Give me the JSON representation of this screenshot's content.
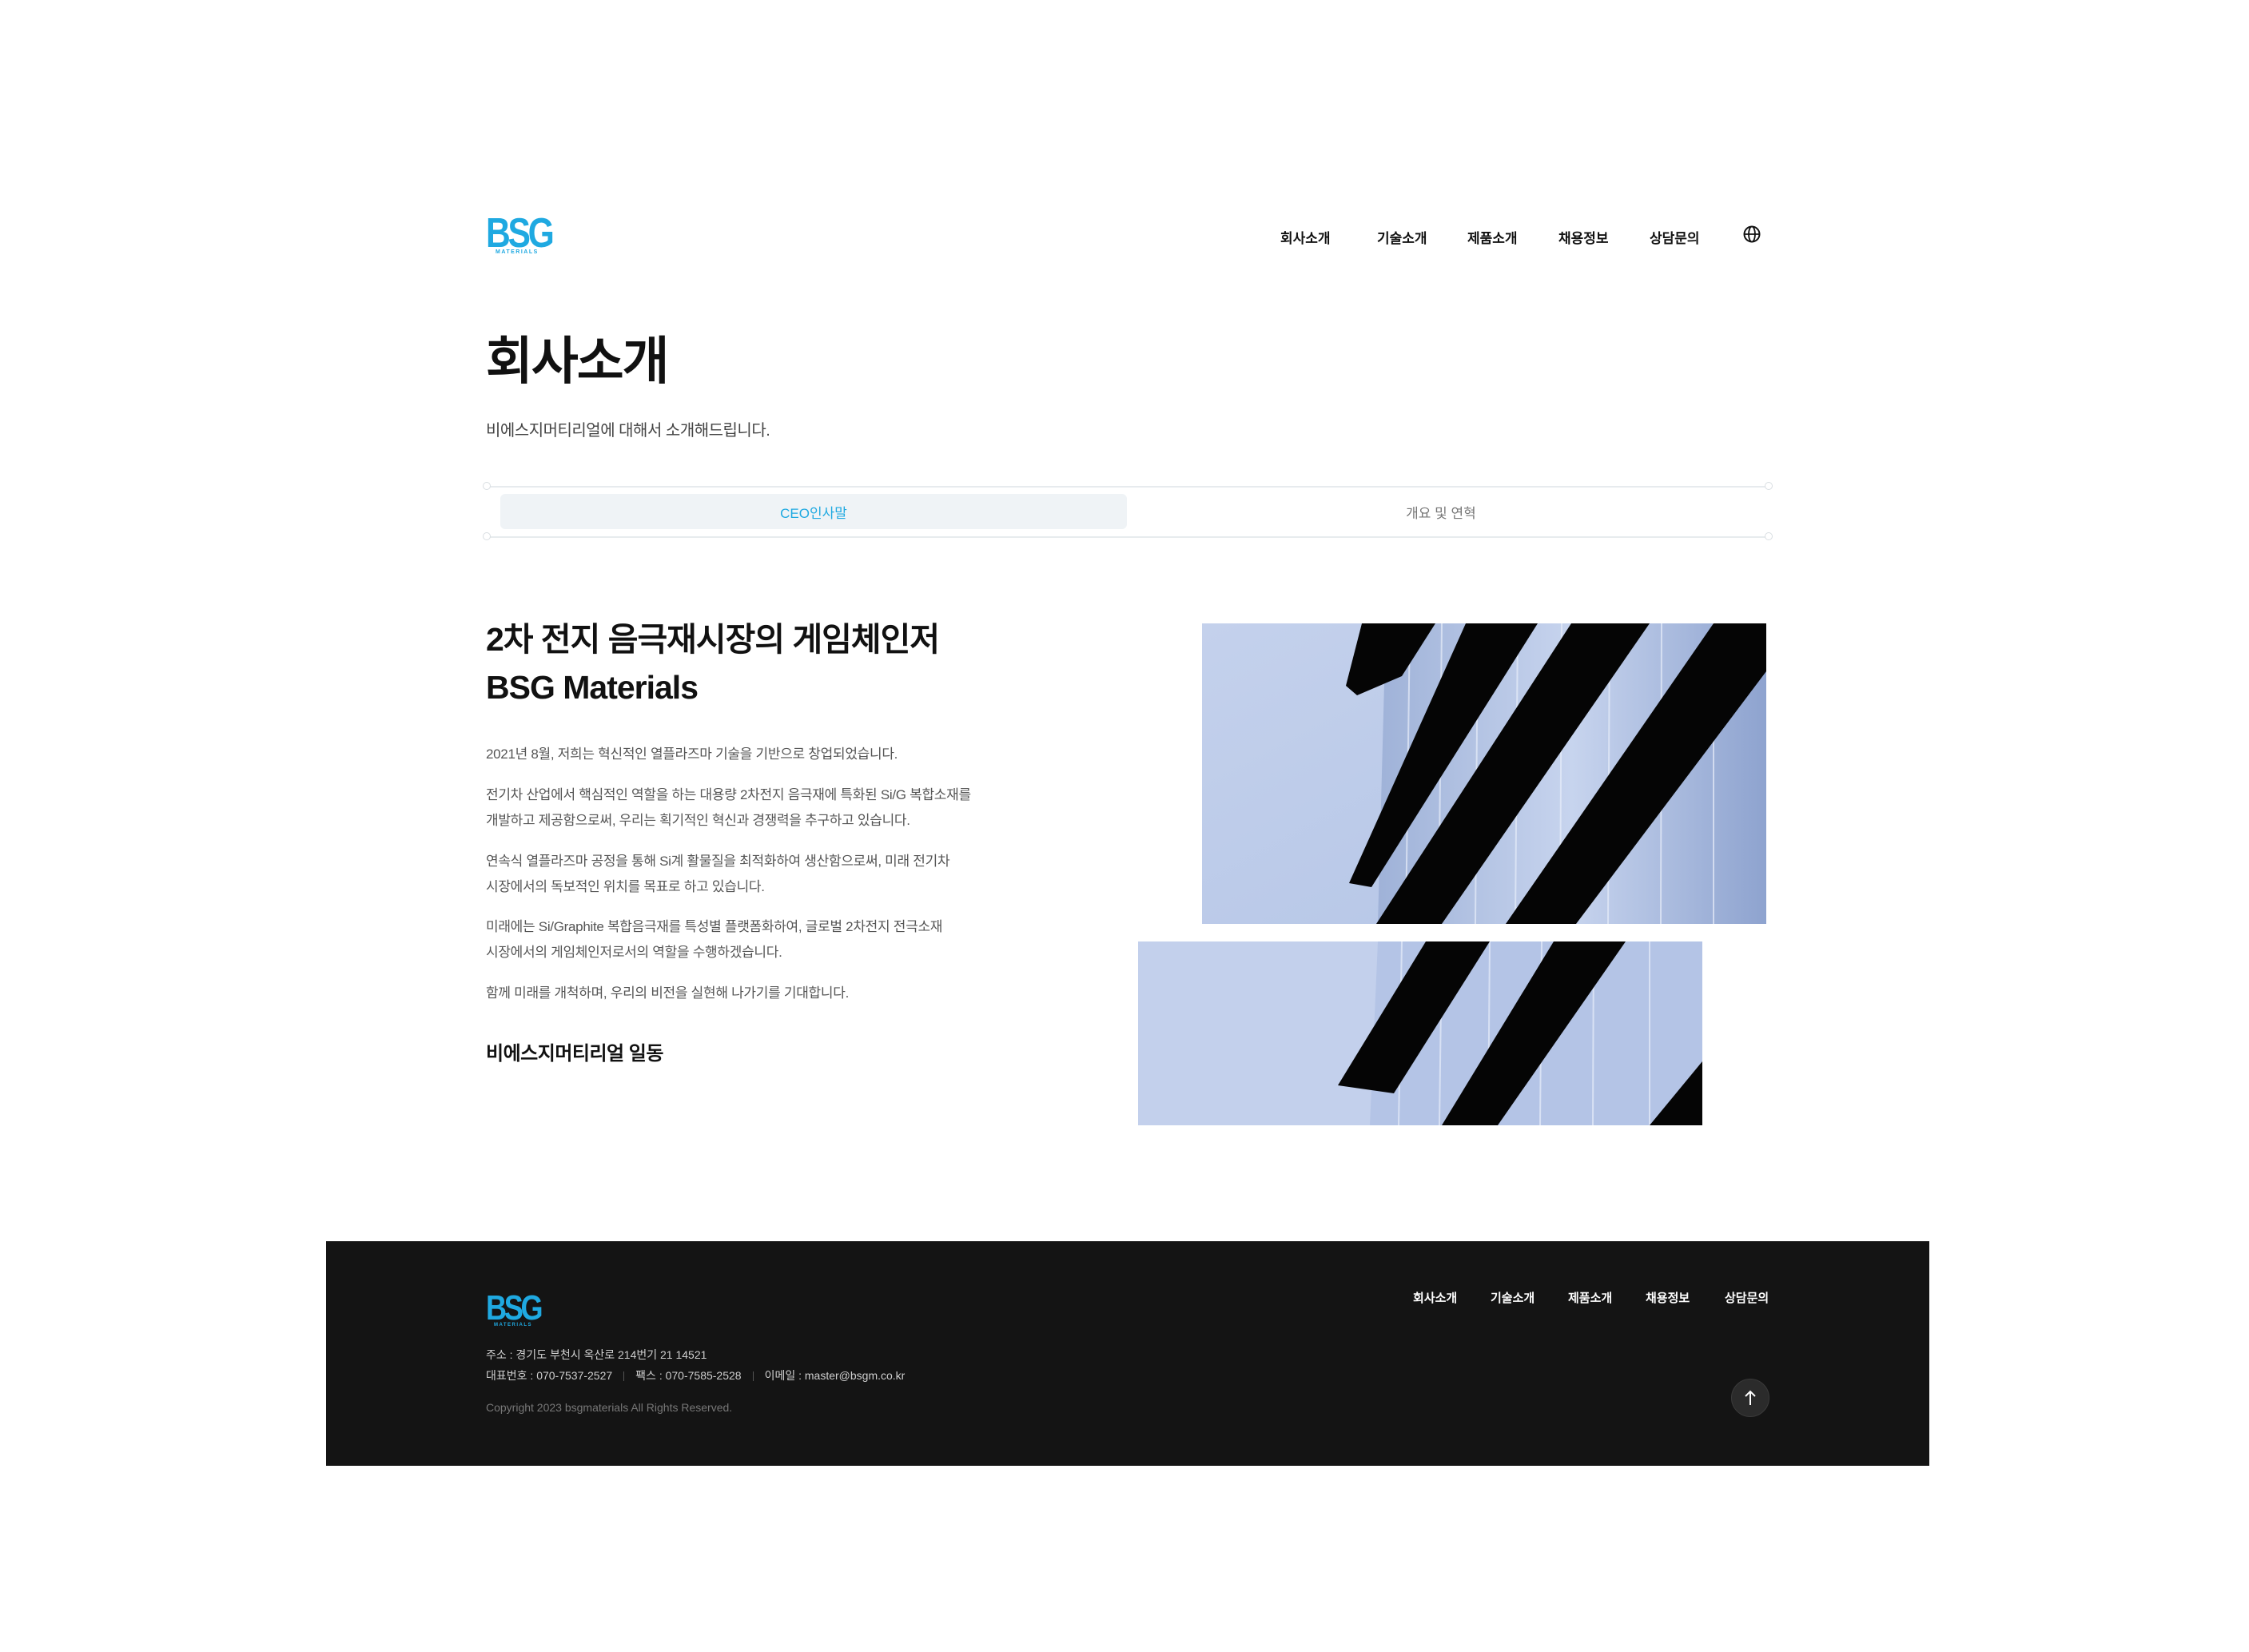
{
  "header": {
    "logo": {
      "mark": "BSG",
      "sub": "MATERIALS"
    },
    "nav": [
      "회사소개",
      "기술소개",
      "제품소개",
      "채용정보",
      "상담문의"
    ],
    "language_icon": "globe-icon"
  },
  "page": {
    "title": "회사소개",
    "subtitle": "비에스지머티리얼에 대해서 소개해드립니다."
  },
  "tabs": [
    {
      "label": "CEO인사말",
      "active": true
    },
    {
      "label": "개요 및 연혁",
      "active": false
    }
  ],
  "content": {
    "headline_line1": "2차 전지 음극재시장의 게임체인저",
    "headline_line2": "BSG Materials",
    "paragraphs": [
      [
        "2021년 8월, 저희는 혁신적인 열플라즈마 기술을 기반으로 창업되었습니다."
      ],
      [
        "전기차 산업에서 핵심적인 역할을 하는 대용량 2차전지 음극재에 특화된 Si/G 복합소재를",
        "개발하고 제공함으로써, 우리는 획기적인 혁신과 경쟁력을 추구하고 있습니다."
      ],
      [
        "연속식 열플라즈마 공정을 통해 Si계 활물질을 최적화하여 생산함으로써, 미래 전기차",
        "시장에서의 독보적인 위치를 목표로 하고 있습니다."
      ],
      [
        "미래에는 Si/Graphite 복합음극재를 특성별 플랫폼화하여, 글로벌 2차전지 전극소재",
        "시장에서의 게임체인저로서의 역할을 수행하겠습니다."
      ],
      [
        "함께 미래를 개척하며, 우리의 비전을 실현해 나가기를 기대합니다."
      ]
    ],
    "signature": "비에스지머티리얼 일동"
  },
  "footer": {
    "logo": {
      "mark": "BSG",
      "sub": "MATERIALS"
    },
    "nav": [
      "회사소개",
      "기술소개",
      "제품소개",
      "채용정보",
      "상담문의"
    ],
    "address": "주소 : 경기도 부천시 옥산로 214번기 21 14521",
    "phone": "대표번호 : 070-7537-2527",
    "fax": "팩스 : 070-7585-2528",
    "email": "이메일 : master@bsgm.co.kr",
    "copyright": "Copyright 2023 bsgmaterials All Rights Reserved.",
    "top_button_icon": "arrow-up-icon"
  },
  "colors": {
    "accent": "#1fa9e1",
    "footer_bg": "#141414",
    "tab_bg": "#eff3f6"
  }
}
